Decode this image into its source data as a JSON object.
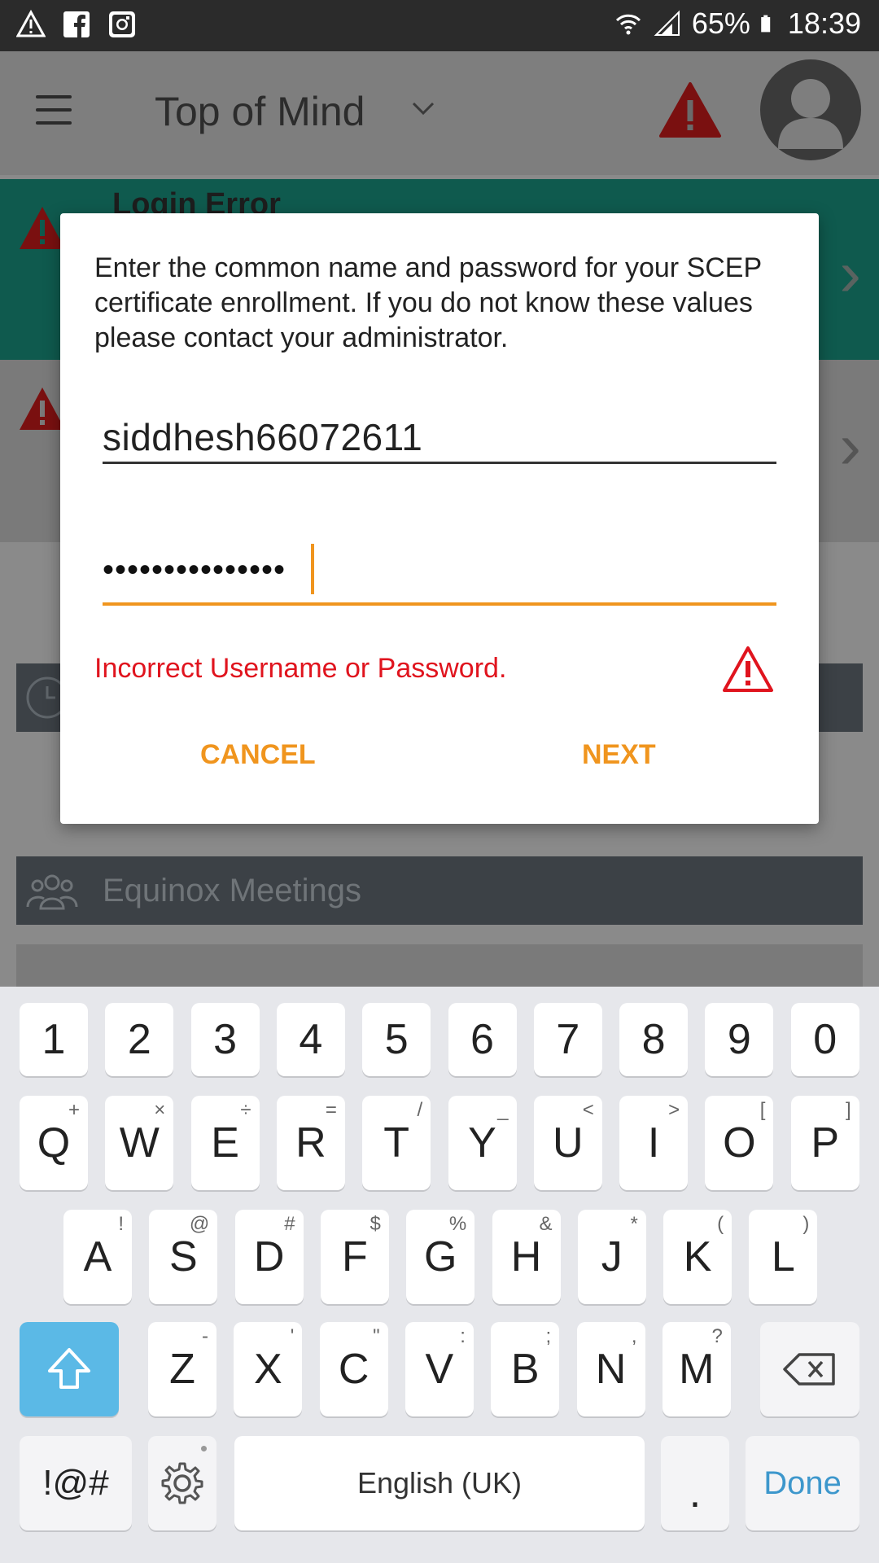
{
  "status_bar": {
    "battery": "65%",
    "time": "18:39",
    "left_icons": [
      "warning-icon",
      "facebook-icon",
      "instagram-icon"
    ],
    "right_icons": [
      "wifi-icon",
      "signal-icon",
      "battery-icon"
    ]
  },
  "app_bar": {
    "title": "Top of Mind",
    "icons": [
      "menu-icon",
      "chevron-down-icon",
      "warning-icon",
      "avatar-icon"
    ]
  },
  "background": {
    "card_title": "Login Error",
    "meetings_label": "Equinox Meetings"
  },
  "dialog": {
    "message": "Enter the common name and password for your SCEP certificate enrollment. If you do not know these values please contact your administrator.",
    "username_value": "siddhesh66072611",
    "password_masked": "•••••••••••••••",
    "error_text": "Incorrect Username or Password.",
    "cancel_label": "CANCEL",
    "next_label": "NEXT"
  },
  "keyboard": {
    "row_numbers": [
      "1",
      "2",
      "3",
      "4",
      "5",
      "6",
      "7",
      "8",
      "9",
      "0"
    ],
    "row_q": [
      {
        "k": "Q",
        "s": "+"
      },
      {
        "k": "W",
        "s": "×"
      },
      {
        "k": "E",
        "s": "÷"
      },
      {
        "k": "R",
        "s": "="
      },
      {
        "k": "T",
        "s": "/"
      },
      {
        "k": "Y",
        "s": "_"
      },
      {
        "k": "U",
        "s": "<"
      },
      {
        "k": "I",
        "s": ">"
      },
      {
        "k": "O",
        "s": "["
      },
      {
        "k": "P",
        "s": "]"
      }
    ],
    "row_a": [
      {
        "k": "A",
        "s": "!"
      },
      {
        "k": "S",
        "s": "@"
      },
      {
        "k": "D",
        "s": "#"
      },
      {
        "k": "F",
        "s": "$"
      },
      {
        "k": "G",
        "s": "%"
      },
      {
        "k": "H",
        "s": "&"
      },
      {
        "k": "J",
        "s": "*"
      },
      {
        "k": "K",
        "s": "("
      },
      {
        "k": "L",
        "s": ")"
      }
    ],
    "row_z": [
      {
        "k": "Z",
        "s": "-"
      },
      {
        "k": "X",
        "s": "'"
      },
      {
        "k": "C",
        "s": "\""
      },
      {
        "k": "V",
        "s": ":"
      },
      {
        "k": "B",
        "s": ";"
      },
      {
        "k": "N",
        "s": ","
      },
      {
        "k": "M",
        "s": "?"
      }
    ],
    "symbols_label": "!@#",
    "space_label": "English (UK)",
    "period_label": ".",
    "done_label": "Done"
  },
  "colors": {
    "accent": "#f0951e",
    "error": "#e0141e",
    "shift": "#5bb9e6",
    "done": "#3d97cc"
  }
}
